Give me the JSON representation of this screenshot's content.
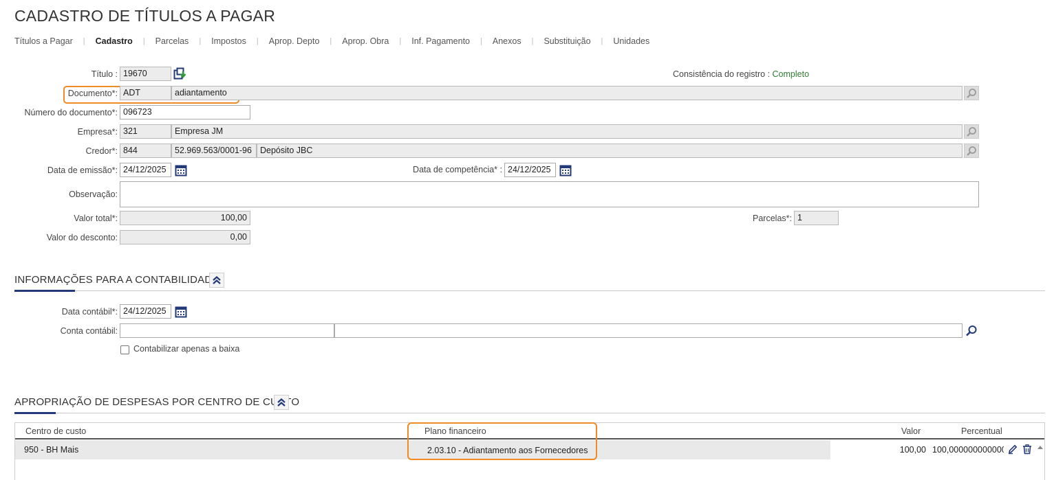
{
  "page": {
    "title": "CADASTRO DE TÍTULOS A PAGAR"
  },
  "tabs": [
    {
      "label": "Títulos a Pagar",
      "active": false
    },
    {
      "label": "Cadastro",
      "active": true
    },
    {
      "label": "Parcelas",
      "active": false
    },
    {
      "label": "Impostos",
      "active": false
    },
    {
      "label": "Aprop. Depto",
      "active": false
    },
    {
      "label": "Aprop. Obra",
      "active": false
    },
    {
      "label": "Inf. Pagamento",
      "active": false
    },
    {
      "label": "Anexos",
      "active": false
    },
    {
      "label": "Substituição",
      "active": false
    },
    {
      "label": "Unidades",
      "active": false
    }
  ],
  "tab_separator": "|",
  "form": {
    "titulo": {
      "label": "Título :",
      "value": "19670"
    },
    "consistencia": {
      "label": "Consistência do registro :",
      "value": "Completo"
    },
    "documento": {
      "label": "Documento*:",
      "code": "ADT",
      "description": "adiantamento"
    },
    "numero_documento": {
      "label": "Número do documento*:",
      "value": "096723"
    },
    "empresa": {
      "label": "Empresa*:",
      "code": "321",
      "name": "Empresa JM"
    },
    "credor": {
      "label": "Credor*:",
      "code": "844",
      "cnpj": "52.969.563/0001-96",
      "name": "Depósito JBC"
    },
    "data_emissao": {
      "label": "Data de emissão*:",
      "value": "24/12/2025"
    },
    "data_competencia": {
      "label": "Data de competência* :",
      "value": "24/12/2025"
    },
    "observacao": {
      "label": "Observação:",
      "value": ""
    },
    "valor_total": {
      "label": "Valor total*:",
      "value": "100,00"
    },
    "parcelas": {
      "label": "Parcelas*:",
      "value": "1"
    },
    "valor_desconto": {
      "label": "Valor do desconto:",
      "value": "0,00"
    }
  },
  "contabilidade": {
    "title": "INFORMAÇÕES PARA A CONTABILIDADE",
    "data_contabil": {
      "label": "Data contábil*:",
      "value": "24/12/2025"
    },
    "conta_contabil": {
      "label": "Conta contábil:",
      "code": "",
      "description": ""
    },
    "contabilizar_baixa": {
      "label": "Contabilizar apenas a baixa",
      "checked": false
    }
  },
  "apropriacao": {
    "title": "APROPRIAÇÃO DE DESPESAS POR CENTRO DE CUSTO",
    "columns": {
      "centro_custo": "Centro de custo",
      "plano_financeiro": "Plano financeiro",
      "valor": "Valor",
      "percentual": "Percentual"
    },
    "rows": [
      {
        "centro_custo": "950 - BH Mais",
        "plano_financeiro": "2.03.10 - Adiantamento aos Fornecedores",
        "valor": "100,00",
        "percentual": "100,000000000000"
      }
    ]
  },
  "icons": {
    "copy": "copy-arrow-icon",
    "search": "magnifier-icon",
    "calendar": "calendar-icon",
    "collapse": "double-chevron-up-icon",
    "edit": "pencil-icon",
    "delete": "trash-icon"
  },
  "colors": {
    "highlight": "#f08a24",
    "accent": "#233a7a",
    "status_ok": "#2e7d32"
  }
}
